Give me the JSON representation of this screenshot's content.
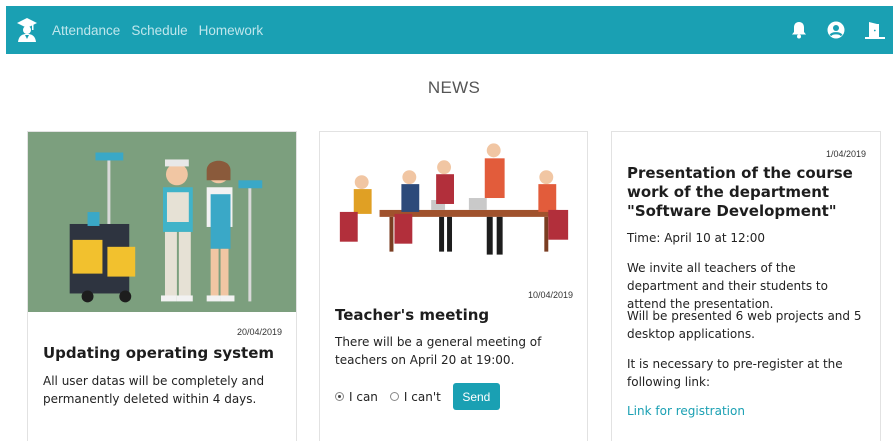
{
  "header": {
    "nav": [
      "Attendance",
      "Schedule",
      "Homework"
    ],
    "brand_color": "#1aa0b3",
    "icons": [
      "graduate-logo-icon",
      "bell-icon",
      "user-circle-icon",
      "exit-door-icon"
    ]
  },
  "main": {
    "title": "NEWS",
    "cards": [
      {
        "date": "20/04/2019",
        "title": "Updating operating system",
        "text": "All user datas will be completely and permanently deleted within 4 days."
      },
      {
        "date": "10/04/2019",
        "title": "Teacher's meeting",
        "text": "There will be a general meeting of teachers on April 20 at 19:00.",
        "options": [
          "I can",
          "I can't"
        ],
        "selected_option": "I can",
        "button": "Send"
      },
      {
        "date": "1/04/2019",
        "title": "Presentation of the course work of the department \"Software Development\"",
        "time": "Time: April 10 at 12:00",
        "p1": "We invite all teachers of the department and their students to attend the presentation.",
        "p2": "Will be presented 6 web projects and 5 desktop applications.",
        "p3": "It is necessary to pre-register at the following link:",
        "link": "Link for registration"
      }
    ]
  }
}
